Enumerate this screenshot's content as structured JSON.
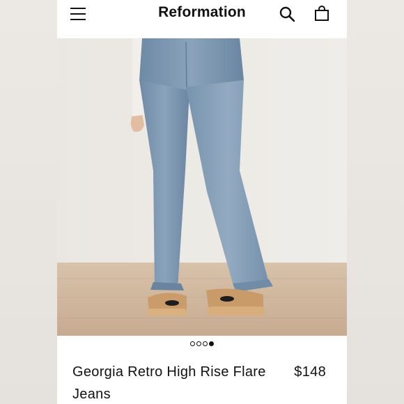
{
  "header": {
    "brand": "Reformation",
    "icons": {
      "menu": "menu-icon",
      "search": "search-icon",
      "bag": "shopping-bag-icon"
    }
  },
  "gallery": {
    "image_count": 4,
    "active_index": 3
  },
  "product": {
    "name": "Georgia Retro High Rise Flare Jeans",
    "price": "$148"
  },
  "colors": {
    "text": "#111111",
    "background": "#ffffff",
    "denim": "#7d98b3"
  }
}
